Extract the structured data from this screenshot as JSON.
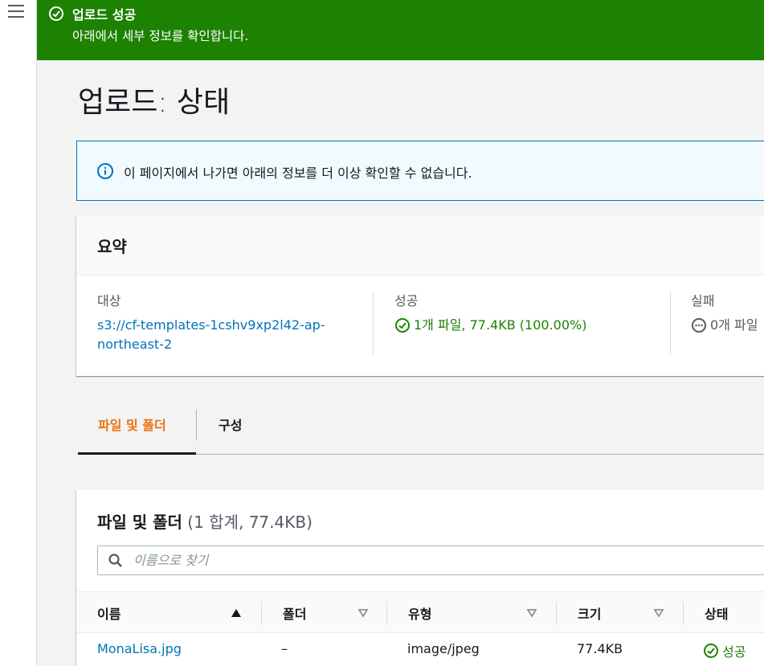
{
  "flash": {
    "title": "업로드 성공",
    "message": "아래에서 세부 정보를 확인합니다."
  },
  "page": {
    "title": "업로드: 상태"
  },
  "info": {
    "text": "이 페이지에서 나가면 아래의 정보를 더 이상 확인할 수 없습니다."
  },
  "summary": {
    "title": "요약",
    "target_label": "대상",
    "target_value": "s3://cf-templates-1cshv9xp2l42-ap-northeast-2",
    "success_label": "성공",
    "success_value": "1개 파일, 77.4KB (100.00%)",
    "fail_label": "실패",
    "fail_value": "0개 파일"
  },
  "tabs": [
    {
      "label": "파일 및 폴더"
    },
    {
      "label": "구성"
    }
  ],
  "files": {
    "title": "파일 및 폴더",
    "count": "(1 합계, 77.4KB)",
    "search_placeholder": "이름으로 찾기",
    "columns": [
      "이름",
      "폴더",
      "유형",
      "크기",
      "상태"
    ],
    "rows": [
      {
        "name": "MonaLisa.jpg",
        "folder": "–",
        "type": "image/jpeg",
        "size": "77.4KB",
        "status": "성공"
      }
    ]
  },
  "colors": {
    "success": "#1d8102",
    "link": "#0073bb",
    "active_tab": "#ec7211"
  }
}
